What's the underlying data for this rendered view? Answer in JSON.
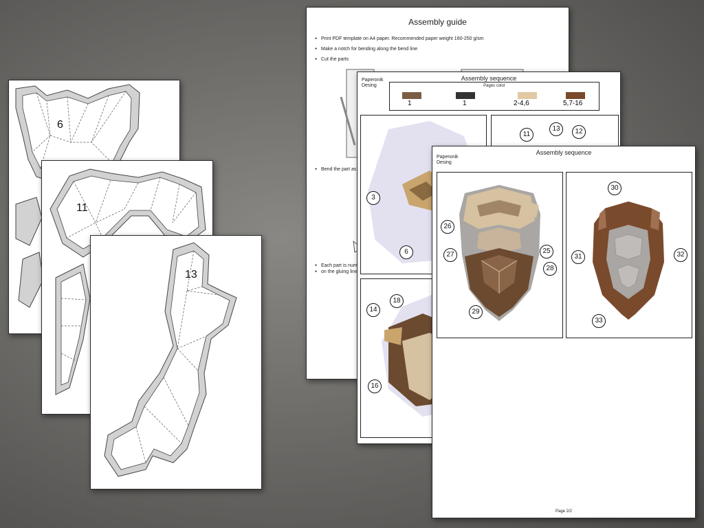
{
  "templates": [
    {
      "part": "6"
    },
    {
      "part": "11"
    },
    {
      "part": "13"
    }
  ],
  "guide": {
    "title": "Assembly guide",
    "bullets": [
      "Print PDF template on A4 paper. Recommended paper weight 160-250 g/sm",
      "Make a notch for bending along the bend line",
      "Cut the parts",
      "Bend the part as",
      "Each part is num",
      "on the gluing line"
    ]
  },
  "sequence_page1": {
    "title": "Assembly sequence",
    "brand": "Paperonik\nDesing",
    "legend_title": "Pages color",
    "legend": [
      {
        "color": "#7b5f45",
        "label": "1"
      },
      {
        "color": "#333333",
        "label": "1"
      },
      {
        "color": "#e0c9a3",
        "label": "2-4,6"
      },
      {
        "color": "#7a4a2c",
        "label": "5,7-16"
      }
    ],
    "callouts": [
      "3",
      "6",
      "11",
      "13",
      "12",
      "14",
      "18",
      "16"
    ]
  },
  "sequence_page2": {
    "title": "Assembly sequence",
    "brand": "Paperonik\nDesing",
    "callouts_left": [
      "26",
      "25",
      "27",
      "28",
      "29"
    ],
    "callouts_right": [
      "30",
      "31",
      "32",
      "33"
    ],
    "page": "Page 2/2"
  },
  "colors": {
    "beige": "#d6c1a0",
    "light_brown": "#a08566",
    "dark_brown": "#6b4a30",
    "gray": "#a9a6a3",
    "fold_gray": "#d2d2d2"
  }
}
